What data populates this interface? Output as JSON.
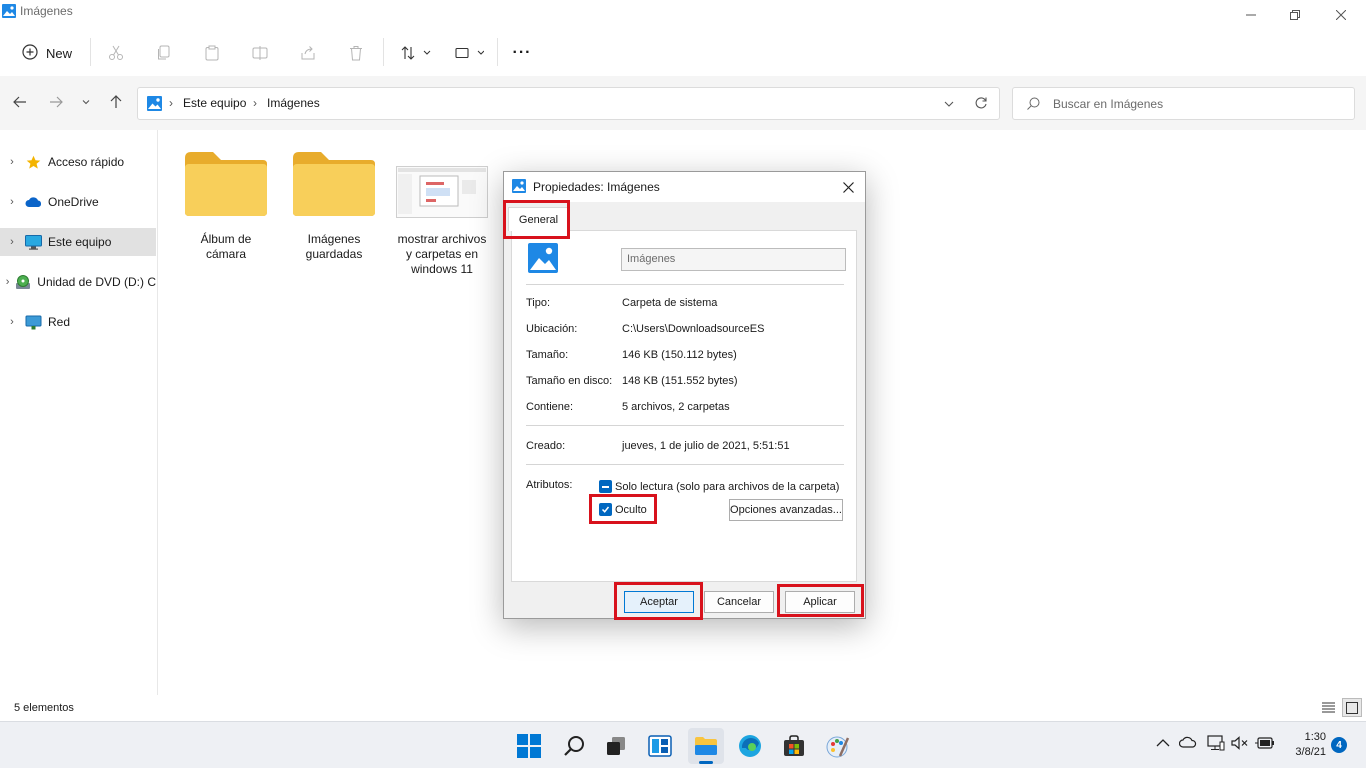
{
  "window": {
    "title": "Imágenes"
  },
  "commandbar": {
    "new_label": "New",
    "more_label": "···"
  },
  "address": {
    "crumbs": [
      "Este equipo",
      "Imágenes"
    ],
    "search_placeholder": "Buscar en Imágenes"
  },
  "sidebar": {
    "items": [
      {
        "label": "Acceso rápido",
        "icon": "star-icon"
      },
      {
        "label": "OneDrive",
        "icon": "cloud-icon"
      },
      {
        "label": "Este equipo",
        "icon": "computer-icon",
        "selected": true
      },
      {
        "label": "Unidad de DVD (D:) C",
        "icon": "dvd-icon"
      },
      {
        "label": "Red",
        "icon": "network-icon"
      }
    ]
  },
  "content": {
    "items": [
      {
        "line1": "Álbum de",
        "line2": "cámara",
        "line3": "",
        "type": "folder"
      },
      {
        "line1": "Imágenes",
        "line2": "guardadas",
        "line3": "",
        "type": "folder"
      },
      {
        "line1": "mostrar archivos",
        "line2": "y carpetas en",
        "line3": "windows 11",
        "type": "image"
      }
    ]
  },
  "status": {
    "count": "5 elementos"
  },
  "dialog": {
    "title": "Propiedades: Imágenes",
    "tab": "General",
    "name_value": "Imágenes",
    "props": [
      {
        "label": "Tipo:",
        "value": "Carpeta de sistema"
      },
      {
        "label": "Ubicación:",
        "value": "C:\\Users\\DownloadsourceES"
      },
      {
        "label": "Tamaño:",
        "value": "146 KB (150.112 bytes)"
      },
      {
        "label": "Tamaño en disco:",
        "value": "148 KB (151.552 bytes)"
      },
      {
        "label": "Contiene:",
        "value": "5 archivos, 2 carpetas"
      }
    ],
    "created_label": "Creado:",
    "created_value": "jueves, 1 de julio de 2021, 5:51:51",
    "attributes_label": "Atributos:",
    "readonly_label": "Solo lectura (solo para archivos de la carpeta)",
    "hidden_label": "Oculto",
    "hidden_checked": true,
    "advanced_label": "Opciones avanzadas...",
    "ok_label": "Aceptar",
    "cancel_label": "Cancelar",
    "apply_label": "Aplicar"
  },
  "taskbar": {
    "time": "1:30",
    "date": "3/8/21",
    "notifications": "4"
  },
  "colors": {
    "highlight": "#d8121c",
    "accent": "#0067c0",
    "folder": "#f8cf5a"
  }
}
